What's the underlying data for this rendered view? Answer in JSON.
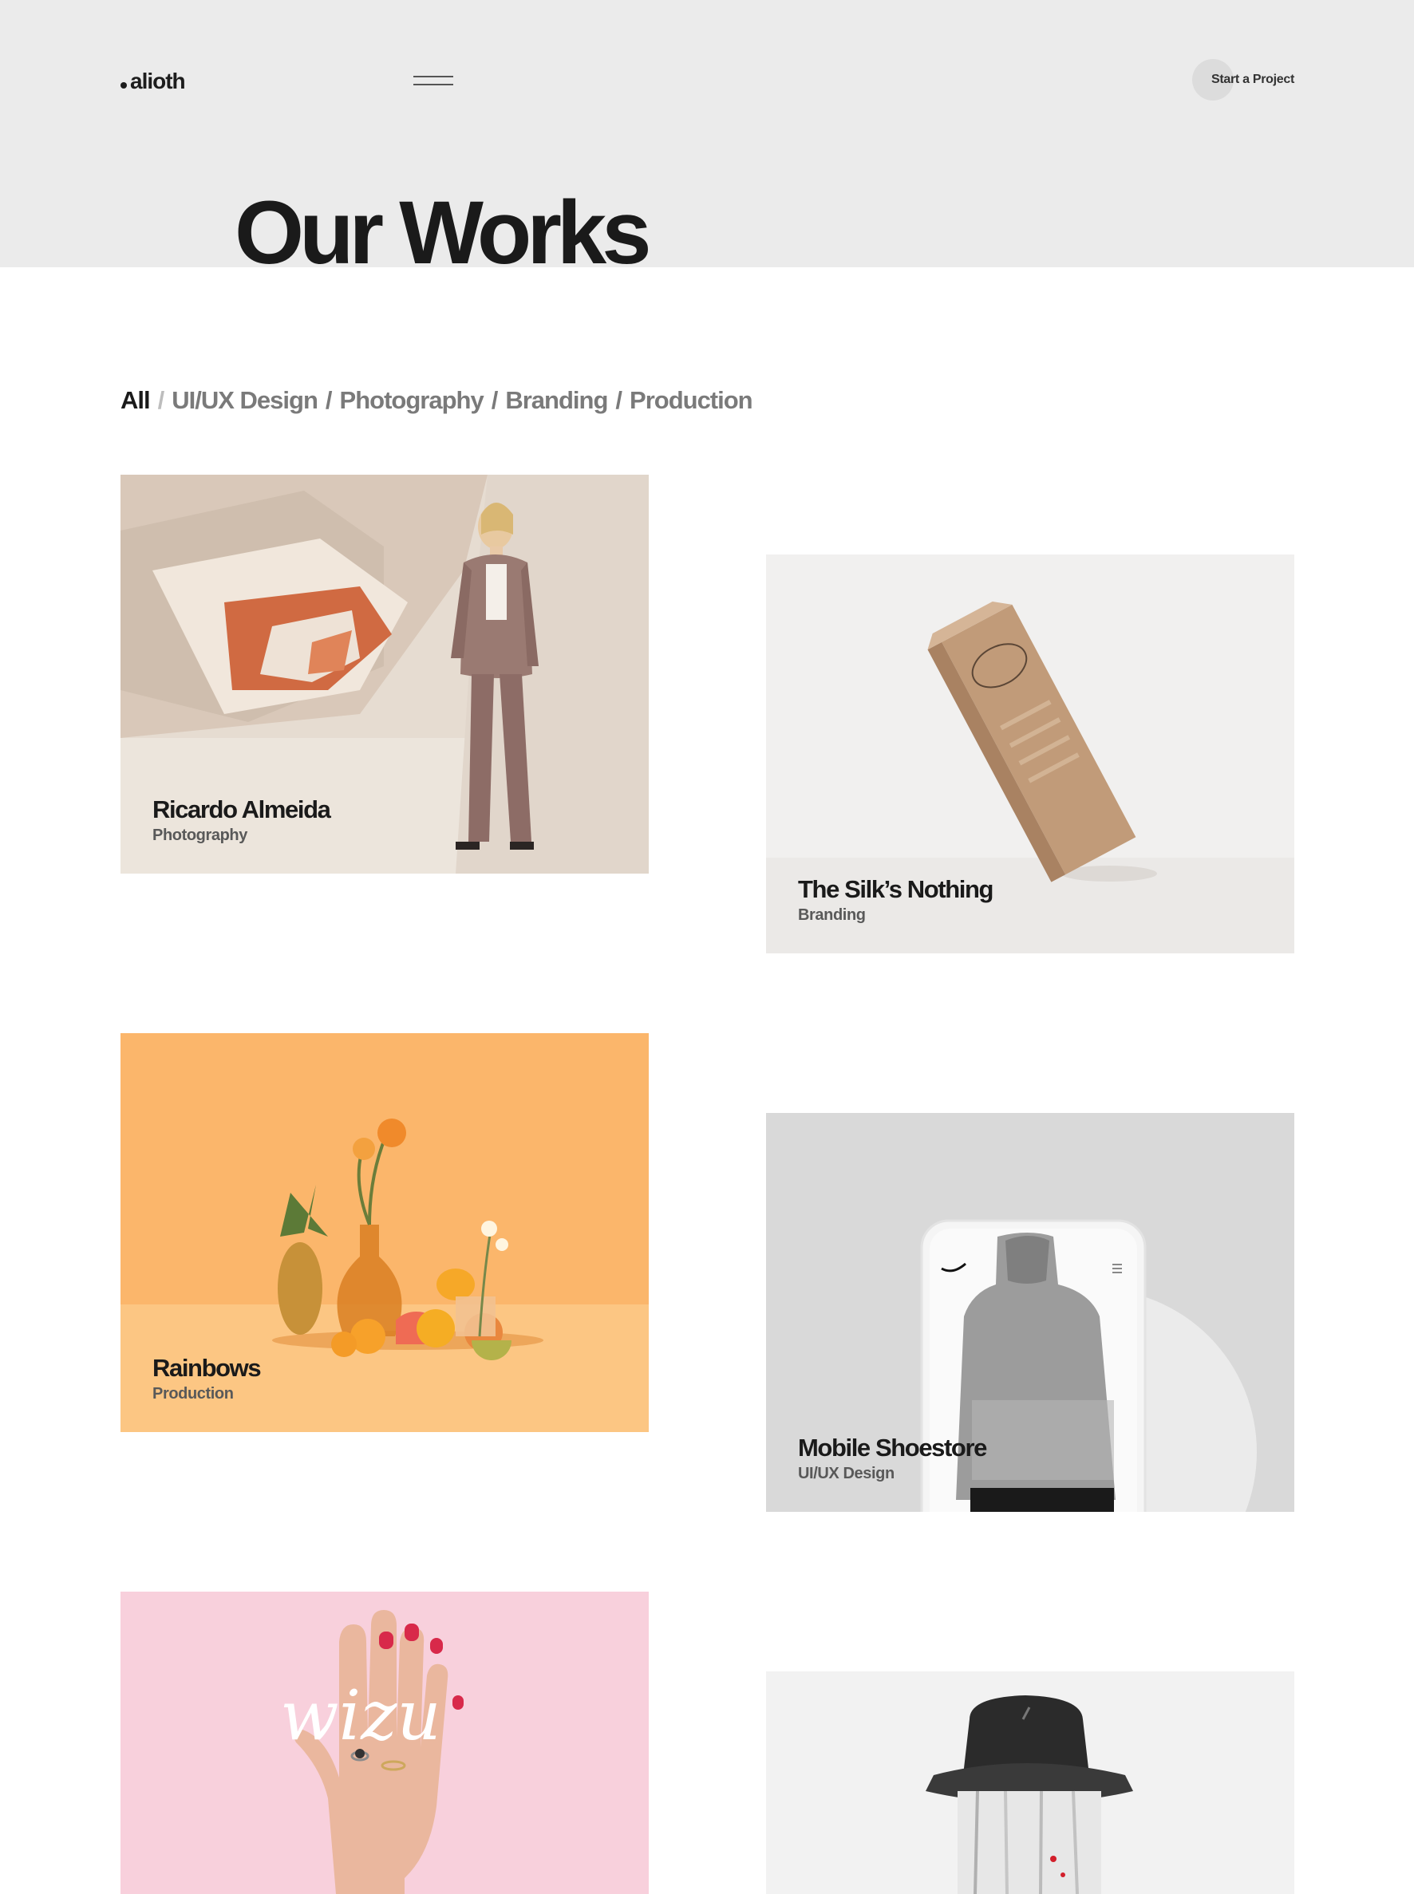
{
  "brand": {
    "name": "alioth"
  },
  "header": {
    "menu_icon": "hamburger-icon",
    "cta_label": "Start a Project"
  },
  "page": {
    "title": "Our Works"
  },
  "filters": [
    {
      "label": "All",
      "active": true
    },
    {
      "label": "UI/UX Design",
      "active": false
    },
    {
      "label": "Photography",
      "active": false
    },
    {
      "label": "Branding",
      "active": false
    },
    {
      "label": "Production",
      "active": false
    }
  ],
  "works": [
    {
      "title": "Ricardo Almeida",
      "category": "Photography"
    },
    {
      "title": "The Silk’s Nothing",
      "category": "Branding"
    },
    {
      "title": "Rainbows",
      "category": "Production"
    },
    {
      "title": "Mobile Shoestore",
      "category": "UI/UX Design"
    },
    {
      "title": "",
      "category": "",
      "image_text": "wizu"
    },
    {
      "title": "",
      "category": ""
    }
  ],
  "colors": {
    "hero_band": "#ebebeb",
    "text_dark": "#1a1a1a",
    "text_muted": "#7a7a7a",
    "card_beige": "#e3d8cc",
    "card_orange": "#fbb86a",
    "card_gray": "#d9d9d9",
    "card_pink": "#f8d0dc"
  }
}
